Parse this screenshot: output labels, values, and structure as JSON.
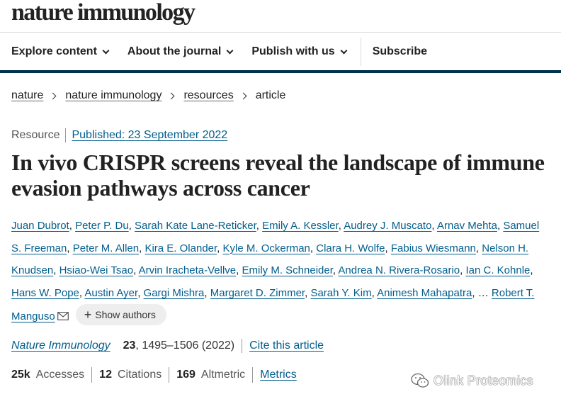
{
  "header": {
    "logo": "nature immunology"
  },
  "nav": {
    "explore": "Explore content",
    "about": "About the journal",
    "publish": "Publish with us",
    "subscribe": "Subscribe"
  },
  "breadcrumbs": [
    "nature",
    "nature immunology",
    "resources",
    "article"
  ],
  "article": {
    "type": "Resource",
    "published": "Published: 23 September 2022",
    "title": "In vivo CRISPR screens reveal the landscape of immune evasion pathways across cancer",
    "authors": [
      "Juan Dubrot",
      "Peter P. Du",
      "Sarah Kate Lane-Reticker",
      "Emily A. Kessler",
      "Audrey J. Muscato",
      "Arnav Mehta",
      "Samuel S. Freeman",
      "Peter M. Allen",
      "Kira E. Olander",
      "Kyle M. Ockerman",
      "Clara H. Wolfe",
      "Fabius Wiesmann",
      "Nelson H. Knudsen",
      "Hsiao-Wei Tsao",
      "Arvin Iracheta-Vellve",
      "Emily M. Schneider",
      "Andrea N. Rivera-Rosario",
      "Ian C. Kohnle",
      "Hans W. Pope",
      "Austin Ayer",
      "Gargi Mishra",
      "Margaret D. Zimmer",
      "Sarah Y. Kim",
      "Animesh Mahapatra"
    ],
    "ellipsis": "…",
    "last_author": "Robert T. Manguso",
    "show_authors": "Show authors"
  },
  "citation": {
    "journal": "Nature Immunology",
    "volume": "23",
    "pages": ", 1495–1506 (2022)",
    "cite_link": "Cite this article"
  },
  "metrics": {
    "accesses_value": "25k",
    "accesses_label": "Accesses",
    "citations_value": "12",
    "citations_label": "Citations",
    "altmetric_value": "169",
    "altmetric_label": "Altmetric",
    "metrics_link": "Metrics"
  },
  "watermark": {
    "text": "Olink Proteomics"
  },
  "colors": {
    "link": "#025e8d",
    "nav_bar": "#01324b"
  }
}
